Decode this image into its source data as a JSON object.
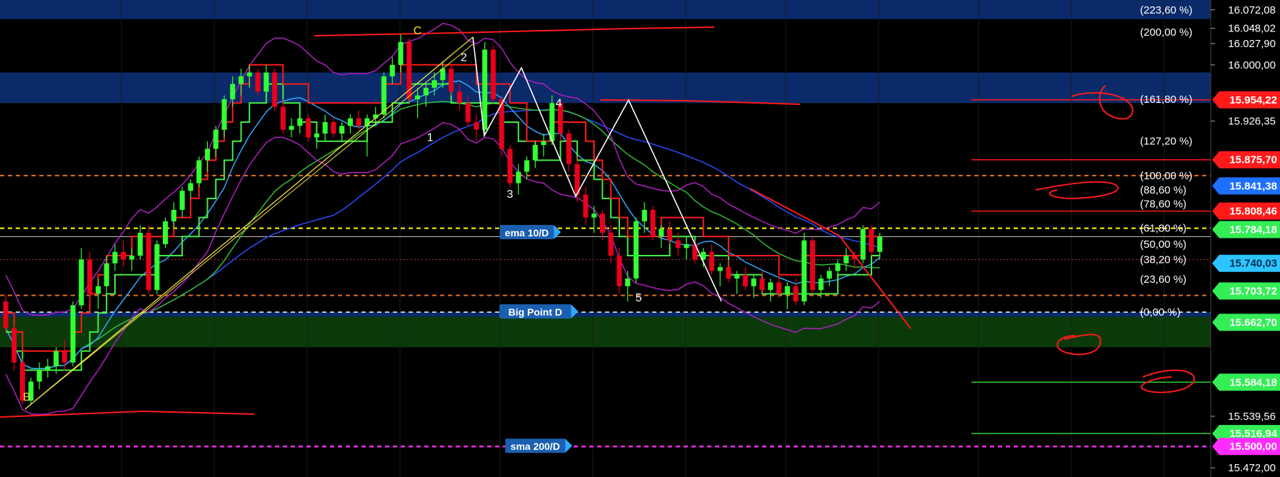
{
  "chart_data": {
    "type": "candlestick",
    "ylim": [
      15460,
      16085
    ],
    "xlim": [
      0,
      120
    ],
    "grid": true,
    "colors": {
      "background": "#000000",
      "candle_up": "#33ff33",
      "candle_down": "#e8001c",
      "fib_band": "#0a2a6a",
      "support_zone": "#0a3a0a",
      "ema10": "#2ea8ff",
      "sma200": "#ff2bff",
      "bollinger": "#b020c0",
      "trend_red": "#ff1a1a",
      "fan_yellow": "#f0e040",
      "green_step": "#44ee44",
      "orange_dash": "#e07020",
      "yellow_dash": "#ffff00"
    },
    "fib_levels": [
      {
        "label": "(223,60 %)",
        "y": 16072.08
      },
      {
        "label": "(200,00 %)",
        "y": 16043.0
      },
      {
        "label": "(161,80 %)",
        "y": 15955.0
      },
      {
        "label": "(127,20 %)",
        "y": 15900.0
      },
      {
        "label": "(100,00 %)",
        "y": 15855.0
      },
      {
        "label": "(88,60 %)",
        "y": 15836.0
      },
      {
        "label": "(78,60 %)",
        "y": 15818.0
      },
      {
        "label": "(61,80 %)",
        "y": 15786.0
      },
      {
        "label": "(50,00 %)",
        "y": 15765.0
      },
      {
        "label": "(38,20 %)",
        "y": 15745.0
      },
      {
        "label": "(23,60 %)",
        "y": 15719.0
      },
      {
        "label": "(0,00 %)",
        "y": 15676.0
      }
    ],
    "axis_labels": [
      {
        "text": "16.072,08",
        "y": 16072.08
      },
      {
        "text": "16.048,02",
        "y": 16048.02
      },
      {
        "text": "16.027,90",
        "y": 16027.9
      },
      {
        "text": "16.000,00",
        "y": 16000.0
      },
      {
        "text": "15.926,35",
        "y": 15926.35
      },
      {
        "text": "15.539,56",
        "y": 15539.56
      },
      {
        "text": "15.472,00",
        "y": 15472.0
      }
    ],
    "price_badges": [
      {
        "text": "15.954,22",
        "y": 15954.22,
        "color": "#ff1a1a",
        "text_color": "#ffffff"
      },
      {
        "text": "15.875,70",
        "y": 15875.7,
        "color": "#ff1a1a",
        "text_color": "#ffffff"
      },
      {
        "text": "15.841,38",
        "y": 15841.38,
        "color": "#1f6fff",
        "text_color": "#ffffff"
      },
      {
        "text": "15.808,46",
        "y": 15808.46,
        "color": "#ff1a1a",
        "text_color": "#ffffff"
      },
      {
        "text": "15.784,18",
        "y": 15784.18,
        "color": "#33ee55",
        "text_color": "#ffffff"
      },
      {
        "text": "15.740,03",
        "y": 15740.03,
        "color": "#2ec4ff",
        "text_color": "#003050"
      },
      {
        "text": "15.703,72",
        "y": 15703.72,
        "color": "#33ee55",
        "text_color": "#ffffff"
      },
      {
        "text": "15.662,70",
        "y": 15662.7,
        "color": "#33ee55",
        "text_color": "#ffffff"
      },
      {
        "text": "15.584,18",
        "y": 15584.18,
        "color": "#33ee55",
        "text_color": "#ffffff"
      },
      {
        "text": "15.516,94",
        "y": 15516.94,
        "color": "#33ee55",
        "text_color": "#ffffff"
      },
      {
        "text": "15.500,00",
        "y": 15500.0,
        "color": "#ff2bff",
        "text_color": "#ffffff"
      }
    ],
    "tags": [
      {
        "text": "ema 10/D",
        "x": 62,
        "y": 15780.0,
        "bg": "#1b5fb0",
        "arrow": "#2ea8ff"
      },
      {
        "text": "Big Point D",
        "x": 63,
        "y": 15676.0,
        "bg": "#1b5fb0",
        "arrow": "#2ea8ff"
      },
      {
        "text": "sma 200/D",
        "x": 63,
        "y": 15500.0,
        "bg": "#1b5fb0",
        "arrow": "#2ea8ff"
      }
    ],
    "wave_labels": [
      {
        "text": "B",
        "x": 2.5,
        "y": 15560,
        "color": "#f0e040"
      },
      {
        "text": "C",
        "x": 49,
        "y": 16040,
        "color": "#f0e040"
      },
      {
        "text": "1",
        "x": 50.5,
        "y": 15900,
        "color": "#ffffff"
      },
      {
        "text": "2",
        "x": 54.5,
        "y": 16005,
        "color": "#ffffff"
      },
      {
        "text": "3",
        "x": 60,
        "y": 15826,
        "color": "#ffffff"
      },
      {
        "text": "4",
        "x": 65.8,
        "y": 15945,
        "color": "#ffffff"
      },
      {
        "text": "5",
        "x": 75.3,
        "y": 15690,
        "color": "#ffffff"
      }
    ],
    "candles": [
      [
        15690,
        15700,
        15650,
        15655
      ],
      [
        15655,
        15660,
        15600,
        15610
      ],
      [
        15610,
        15615,
        15555,
        15560
      ],
      [
        15560,
        15590,
        15555,
        15585
      ],
      [
        15585,
        15610,
        15575,
        15600
      ],
      [
        15600,
        15615,
        15590,
        15605
      ],
      [
        15605,
        15630,
        15595,
        15625
      ],
      [
        15625,
        15640,
        15600,
        15610
      ],
      [
        15610,
        15690,
        15605,
        15685
      ],
      [
        15685,
        15760,
        15680,
        15745
      ],
      [
        15745,
        15755,
        15690,
        15700
      ],
      [
        15700,
        15720,
        15680,
        15710
      ],
      [
        15710,
        15750,
        15700,
        15740
      ],
      [
        15740,
        15765,
        15730,
        15755
      ],
      [
        15755,
        15770,
        15735,
        15745
      ],
      [
        15745,
        15760,
        15730,
        15750
      ],
      [
        15750,
        15790,
        15745,
        15780
      ],
      [
        15780,
        15790,
        15700,
        15705
      ],
      [
        15705,
        15770,
        15700,
        15765
      ],
      [
        15765,
        15800,
        15760,
        15795
      ],
      [
        15795,
        15820,
        15785,
        15810
      ],
      [
        15810,
        15840,
        15800,
        15835
      ],
      [
        15835,
        15850,
        15825,
        15845
      ],
      [
        15845,
        15880,
        15840,
        15875
      ],
      [
        15875,
        15900,
        15860,
        15890
      ],
      [
        15890,
        15920,
        15880,
        15915
      ],
      [
        15915,
        15960,
        15905,
        15955
      ],
      [
        15955,
        15985,
        15945,
        15975
      ],
      [
        15975,
        15995,
        15960,
        15985
      ],
      [
        15985,
        16000,
        15970,
        15990
      ],
      [
        15990,
        15995,
        15960,
        15965
      ],
      [
        15965,
        16000,
        15955,
        15990
      ],
      [
        15990,
        15995,
        15940,
        15945
      ],
      [
        15945,
        15955,
        15910,
        15915
      ],
      [
        15915,
        15930,
        15905,
        15920
      ],
      [
        15920,
        15940,
        15910,
        15930
      ],
      [
        15930,
        15935,
        15900,
        15905
      ],
      [
        15905,
        15915,
        15890,
        15910
      ],
      [
        15910,
        15935,
        15900,
        15925
      ],
      [
        15925,
        15930,
        15905,
        15910
      ],
      [
        15910,
        15925,
        15900,
        15920
      ],
      [
        15920,
        15935,
        15910,
        15930
      ],
      [
        15930,
        15940,
        15915,
        15920
      ],
      [
        15920,
        15935,
        15880,
        15930
      ],
      [
        15930,
        15945,
        15920,
        15935
      ],
      [
        15935,
        15990,
        15930,
        15985
      ],
      [
        15985,
        16010,
        15975,
        16000
      ],
      [
        16000,
        16040,
        15990,
        16030
      ],
      [
        16030,
        16035,
        15950,
        15955
      ],
      [
        15955,
        15970,
        15930,
        15960
      ],
      [
        15960,
        15975,
        15945,
        15970
      ],
      [
        15970,
        15990,
        15960,
        15980
      ],
      [
        15980,
        16005,
        15970,
        15995
      ],
      [
        15995,
        16000,
        15960,
        15965
      ],
      [
        15965,
        15975,
        15940,
        15950
      ],
      [
        15950,
        15960,
        15920,
        15925
      ],
      [
        15925,
        15935,
        15900,
        15915
      ],
      [
        15915,
        16030,
        15910,
        16020
      ],
      [
        16020,
        16025,
        15950,
        15955
      ],
      [
        15955,
        15960,
        15880,
        15890
      ],
      [
        15890,
        15895,
        15840,
        15845
      ],
      [
        15845,
        15870,
        15830,
        15860
      ],
      [
        15860,
        15880,
        15850,
        15875
      ],
      [
        15875,
        15900,
        15865,
        15895
      ],
      [
        15895,
        15910,
        15880,
        15900
      ],
      [
        15900,
        15960,
        15895,
        15950
      ],
      [
        15950,
        15955,
        15900,
        15910
      ],
      [
        15910,
        15915,
        15860,
        15870
      ],
      [
        15870,
        15880,
        15820,
        15830
      ],
      [
        15830,
        15840,
        15790,
        15800
      ],
      [
        15800,
        15815,
        15780,
        15805
      ],
      [
        15805,
        15810,
        15770,
        15780
      ],
      [
        15780,
        15790,
        15740,
        15750
      ],
      [
        15750,
        15760,
        15700,
        15710
      ],
      [
        15710,
        15730,
        15690,
        15720
      ],
      [
        15720,
        15800,
        15715,
        15795
      ],
      [
        15795,
        15820,
        15780,
        15810
      ],
      [
        15810,
        15815,
        15770,
        15775
      ],
      [
        15775,
        15790,
        15760,
        15785
      ],
      [
        15785,
        15795,
        15765,
        15770
      ],
      [
        15770,
        15780,
        15750,
        15760
      ],
      [
        15760,
        15775,
        15745,
        15765
      ],
      [
        15765,
        15770,
        15740,
        15745
      ],
      [
        15745,
        15760,
        15735,
        15755
      ],
      [
        15755,
        15765,
        15725,
        15730
      ],
      [
        15730,
        15740,
        15710,
        15735
      ],
      [
        15735,
        15745,
        15715,
        15720
      ],
      [
        15720,
        15730,
        15700,
        15725
      ],
      [
        15725,
        15735,
        15705,
        15710
      ],
      [
        15710,
        15725,
        15695,
        15720
      ],
      [
        15720,
        15730,
        15700,
        15705
      ],
      [
        15705,
        15720,
        15690,
        15715
      ],
      [
        15715,
        15725,
        15695,
        15700
      ],
      [
        15700,
        15715,
        15680,
        15710
      ],
      [
        15710,
        15720,
        15685,
        15690
      ],
      [
        15690,
        15780,
        15685,
        15770
      ],
      [
        15770,
        15775,
        15700,
        15705
      ],
      [
        15705,
        15725,
        15695,
        15720
      ],
      [
        15720,
        15735,
        15710,
        15730
      ],
      [
        15730,
        15745,
        15720,
        15740
      ],
      [
        15740,
        15760,
        15730,
        15750
      ],
      [
        15750,
        15755,
        15735,
        15745
      ],
      [
        15745,
        15790,
        15740,
        15785
      ],
      [
        15785,
        15790,
        15750,
        15755
      ],
      [
        15755,
        15780,
        15745,
        15775
      ]
    ]
  }
}
